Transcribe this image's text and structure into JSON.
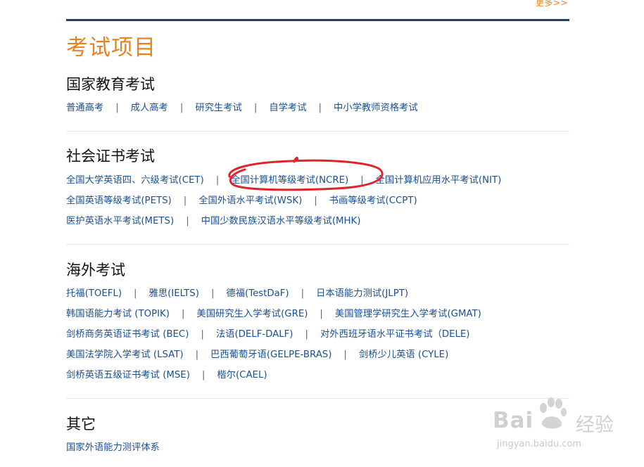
{
  "more_link": "更多>>",
  "page_title": "考试项目",
  "sections": [
    {
      "title": "国家教育考试",
      "rows": [
        [
          "普通高考",
          "成人高考",
          "研究生考试",
          "自学考试",
          "中小学教师资格考试"
        ]
      ]
    },
    {
      "title": "社会证书考试",
      "rows": [
        [
          "全国大学英语四、六级考试(CET)",
          "全国计算机等级考试(NCRE)",
          "全国计算机应用水平考试(NIT)"
        ],
        [
          "全国英语等级考试(PETS)",
          "全国外语水平考试(WSK)",
          "书画等级考试(CCPT)"
        ],
        [
          "医护英语水平考试(METS)",
          "中国少数民族汉语水平等级考试(MHK)"
        ]
      ]
    },
    {
      "title": "海外考试",
      "rows": [
        [
          "托福(TOEFL)",
          "雅思(IELTS)",
          "德福(TestDaF)",
          "日本语能力测试(JLPT)"
        ],
        [
          "韩国语能力考试 (TOPIK)",
          "美国研究生入学考试(GRE)",
          "美国管理学研究生入学考试(GMAT)"
        ],
        [
          "剑桥商务英语证书考试 (BEC)",
          "法语(DELF-DALF)",
          "对外西班牙语水平证书考试（DELE)"
        ],
        [
          "美国法学院入学考试 (LSAT)",
          "巴西葡萄牙语(GELPE-BRAS)",
          "剑桥少儿英语 (CYLE)"
        ],
        [
          "剑桥英语五级证书考试 (MSE)",
          "楷尔(CAEL)"
        ]
      ]
    },
    {
      "title": "其它",
      "rows": [
        [
          "国家外语能力测评体系"
        ]
      ]
    }
  ],
  "separator": "|",
  "annotation_color": "#e0252a",
  "accent_color": "#e8821e",
  "link_color": "#1a4f91",
  "watermark": {
    "brand": "Bai",
    "brand2": "经验",
    "sub": "jingyan.baidu.com"
  }
}
